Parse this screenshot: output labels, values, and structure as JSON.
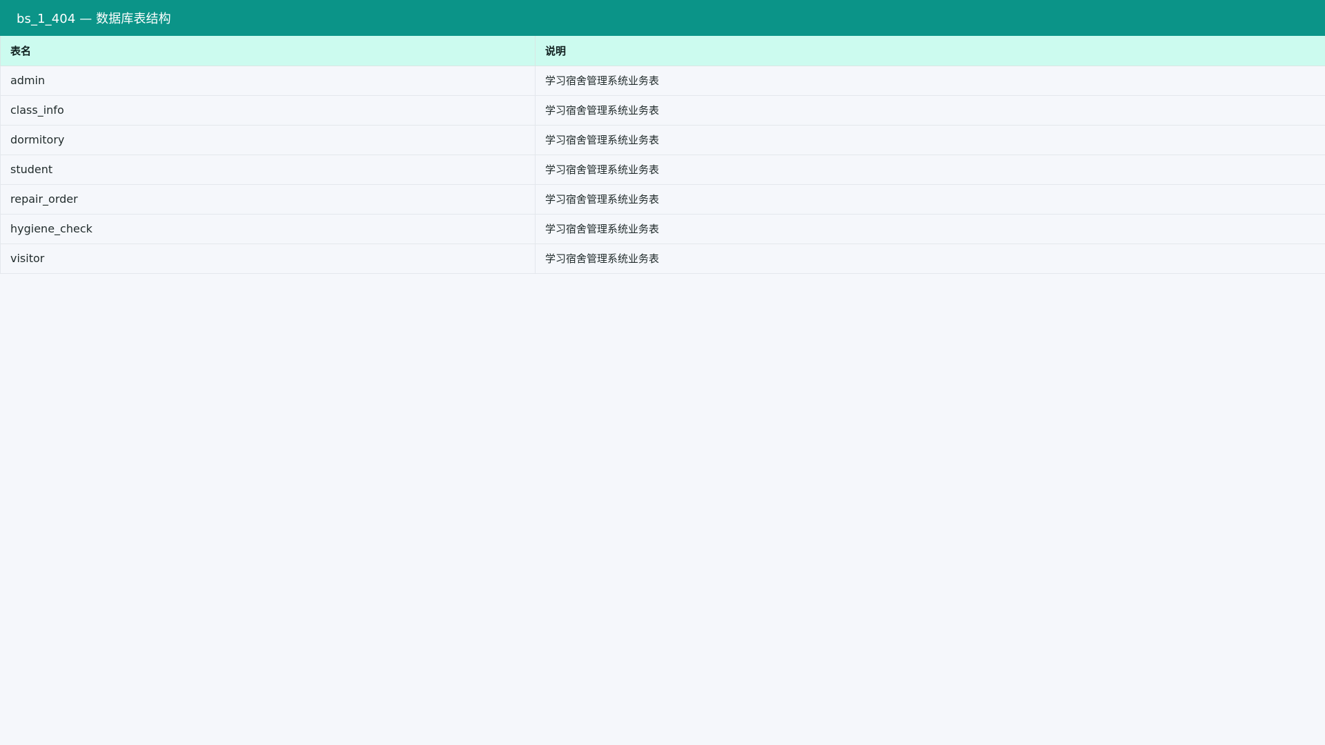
{
  "header": {
    "title": "bs_1_404 — 数据库表结构"
  },
  "colors": {
    "header_bg": "#0b9488",
    "table_header_bg": "#ccfbef",
    "page_bg": "#f5f7fb"
  },
  "table": {
    "columns": [
      "表名",
      "说明"
    ],
    "rows": [
      {
        "name": "admin",
        "desc": "学习宿舍管理系统业务表"
      },
      {
        "name": "class_info",
        "desc": "学习宿舍管理系统业务表"
      },
      {
        "name": "dormitory",
        "desc": "学习宿舍管理系统业务表"
      },
      {
        "name": "student",
        "desc": "学习宿舍管理系统业务表"
      },
      {
        "name": "repair_order",
        "desc": "学习宿舍管理系统业务表"
      },
      {
        "name": "hygiene_check",
        "desc": "学习宿舍管理系统业务表"
      },
      {
        "name": "visitor",
        "desc": "学习宿舍管理系统业务表"
      }
    ]
  }
}
